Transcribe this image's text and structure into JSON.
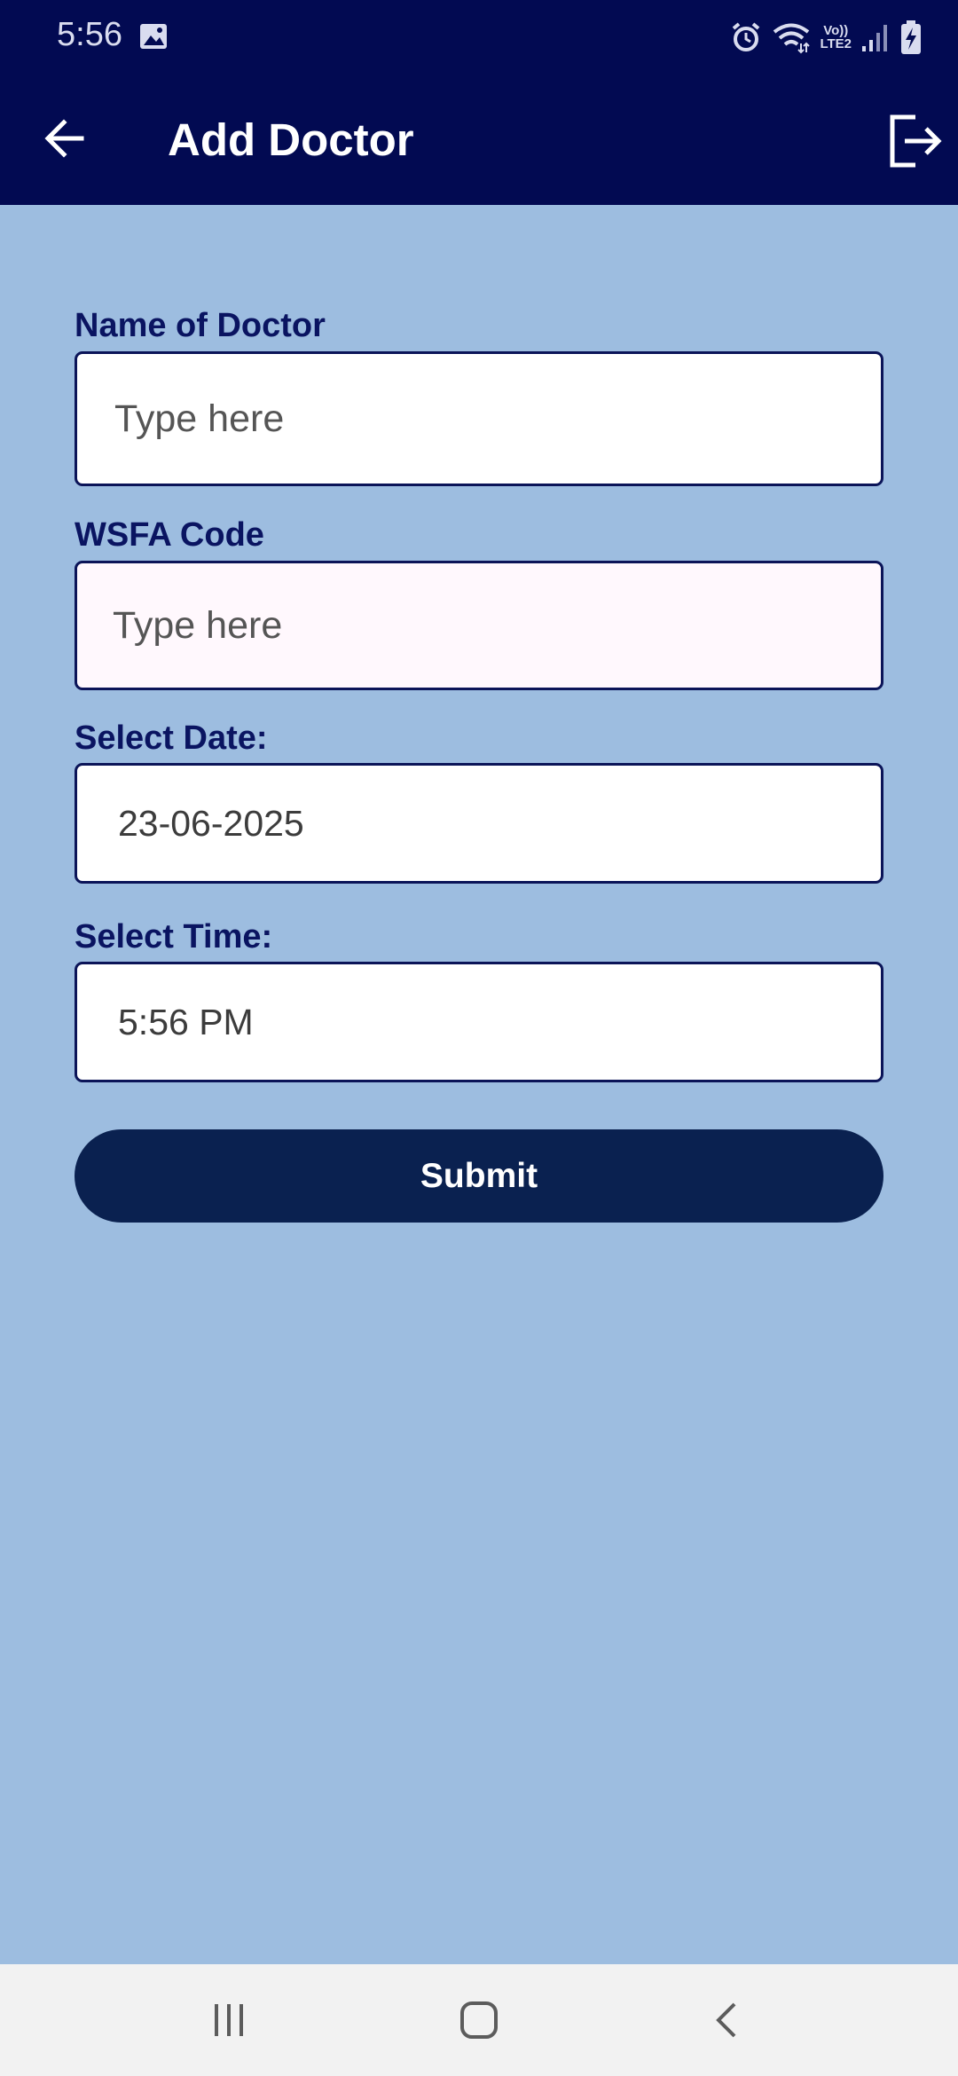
{
  "status_bar": {
    "time": "5:56",
    "network_label_top": "Vo))",
    "network_label_bottom": "LTE2"
  },
  "app_bar": {
    "title": "Add Doctor",
    "back_icon": "arrow-left-icon",
    "logout_icon": "logout-icon"
  },
  "form": {
    "name_label": "Name of Doctor",
    "name_placeholder": "Type here",
    "wsfa_label": "WSFA Code",
    "wsfa_placeholder": "Type here",
    "date_label": "Select Date:",
    "date_value": "23-06-2025",
    "time_label": "Select Time:",
    "time_value": "5:56 PM",
    "submit_label": "Submit"
  },
  "colors": {
    "app_bar": "#020a52",
    "background": "#9dbde0",
    "label_text": "#0a1461",
    "submit_button": "#0a2150"
  },
  "nav_bar": {
    "recents_icon": "recents-icon",
    "home_icon": "home-icon",
    "back_icon": "nav-back-icon"
  }
}
